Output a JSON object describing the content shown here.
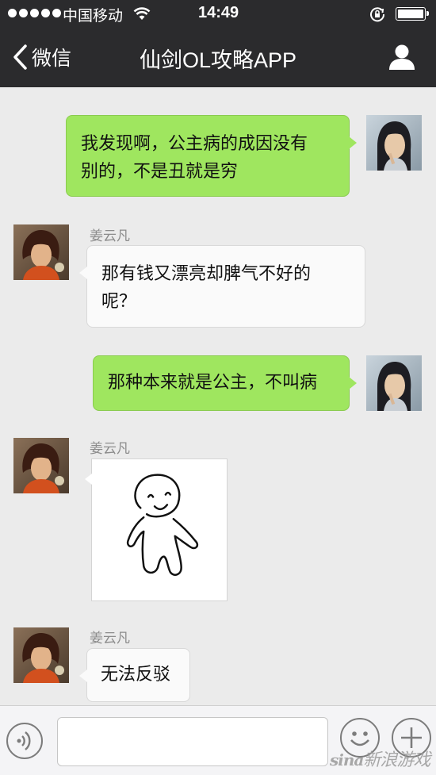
{
  "status_bar": {
    "carrier": "中国移动",
    "time": "14:49",
    "icons": [
      "signal-dots-icon",
      "wifi-icon",
      "rotation-lock-icon",
      "battery-icon"
    ]
  },
  "nav": {
    "back_label": "微信",
    "title": "仙剑OL攻略APP",
    "right_icon": "user-profile-icon"
  },
  "messages": [
    {
      "from": "me",
      "text": "我发现啊，公主病的成因没有别的，不是丑就是穷",
      "line1": "我发现啊，公主病的成因没有",
      "line2": "别的，不是丑就是穷"
    },
    {
      "from": "姜云凡",
      "sender": "姜云凡",
      "text": "那有钱又漂亮却脾气不好的呢？",
      "line1": "那有钱又漂亮却脾气不好的",
      "line2": "呢？"
    },
    {
      "from": "me",
      "text": "那种本来就是公主，不叫病"
    },
    {
      "from": "姜云凡",
      "sender": "姜云凡",
      "type": "sticker",
      "sticker": "smiling-doodle-person"
    },
    {
      "from": "姜云凡",
      "sender": "姜云凡",
      "text": "无法反驳"
    }
  ],
  "input_bar": {
    "voice_icon": "voice-icon",
    "text_value": "",
    "emoji_icon": "emoji-icon",
    "plus_icon": "plus-icon"
  },
  "watermark": {
    "brand": "sina",
    "text": "新浪游戏"
  },
  "colors": {
    "bar_bg": "#2b2b2d",
    "chat_bg": "#ebebeb",
    "my_bubble": "#9fe65f",
    "their_bubble": "#fafafa"
  }
}
